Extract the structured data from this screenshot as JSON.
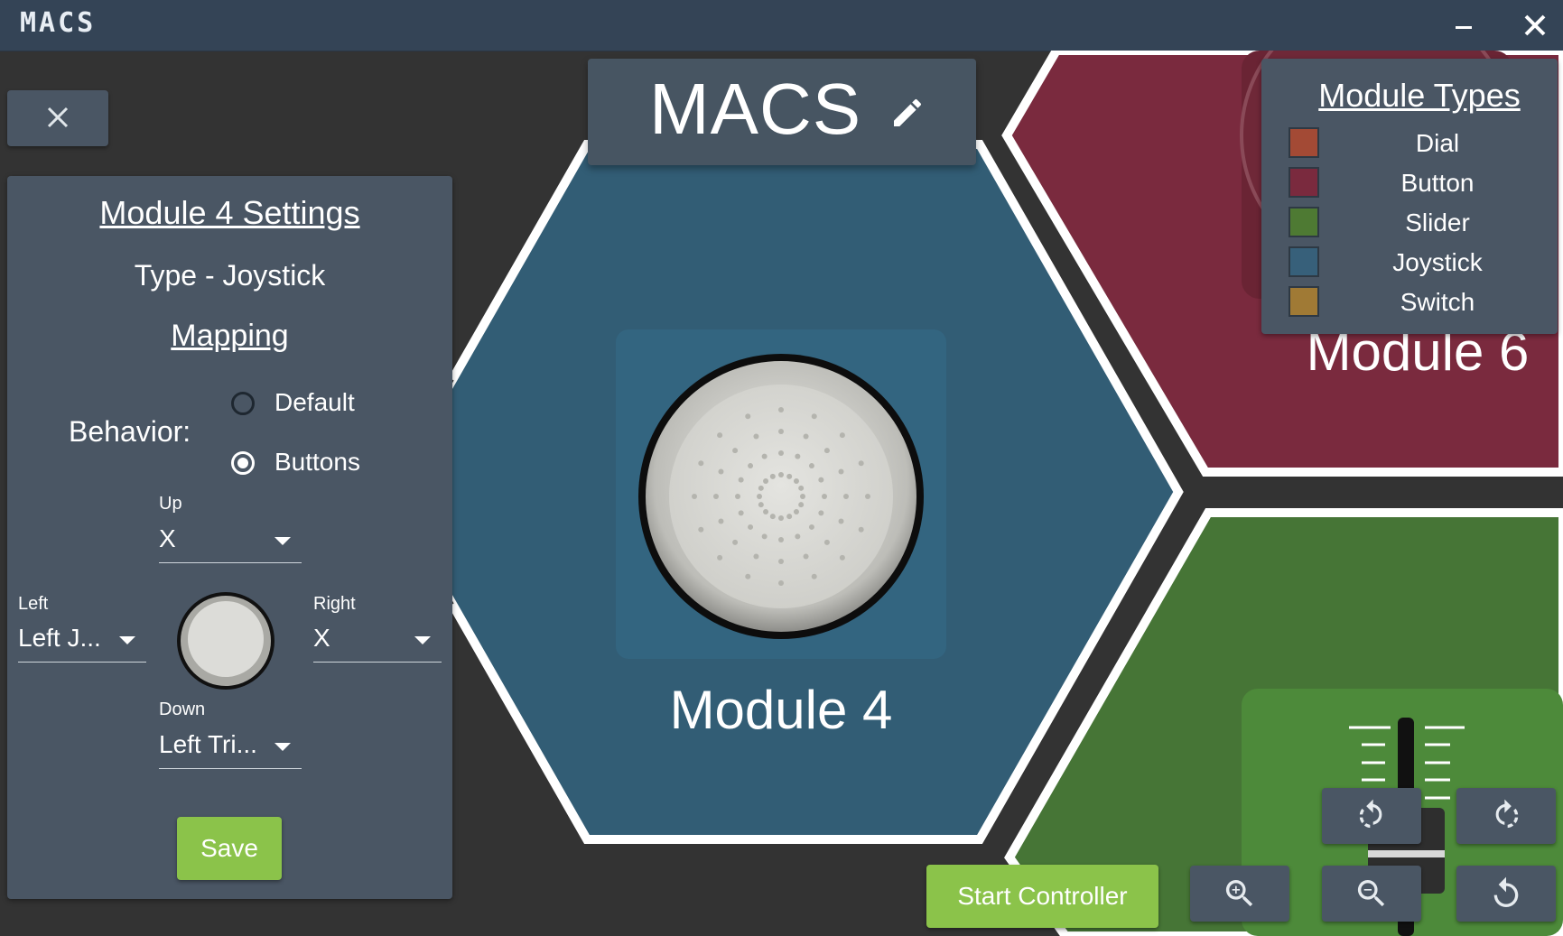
{
  "window": {
    "title": "MACS"
  },
  "controller": {
    "name": "MACS"
  },
  "modules": {
    "center": {
      "label": "Module 4",
      "type": "Joystick"
    },
    "top_right": {
      "label": "Module 6",
      "type": "Button"
    },
    "bottom_right": {
      "type": "Slider"
    }
  },
  "settings": {
    "title": "Module 4 Settings",
    "type_text": "Type - Joystick",
    "mapping_heading": "Mapping",
    "behavior_label": "Behavior:",
    "behavior_options": [
      {
        "label": "Default",
        "checked": false
      },
      {
        "label": "Buttons",
        "checked": true
      }
    ],
    "up": {
      "label": "Up",
      "value": "X"
    },
    "left": {
      "label": "Left",
      "value": "Left J..."
    },
    "right": {
      "label": "Right",
      "value": "X"
    },
    "down": {
      "label": "Down",
      "value": "Left Tri..."
    },
    "save_label": "Save"
  },
  "legend": {
    "title": "Module Types",
    "items": [
      {
        "label": "Dial",
        "color": "#a34a35"
      },
      {
        "label": "Button",
        "color": "#7a2a3e"
      },
      {
        "label": "Slider",
        "color": "#4e7a33"
      },
      {
        "label": "Joystick",
        "color": "#37607a"
      },
      {
        "label": "Switch",
        "color": "#a07a35"
      }
    ]
  },
  "colors": {
    "joystick_module": "#325d75",
    "button_module": "#7a2a3e",
    "slider_module": "#467536",
    "accent_green": "#8bc34a"
  },
  "controls": {
    "start_label": "Start Controller",
    "icons": [
      "rotate-ccw-icon",
      "rotate-cw-icon",
      "zoom-in-icon",
      "zoom-out-icon",
      "reset-view-icon"
    ]
  }
}
